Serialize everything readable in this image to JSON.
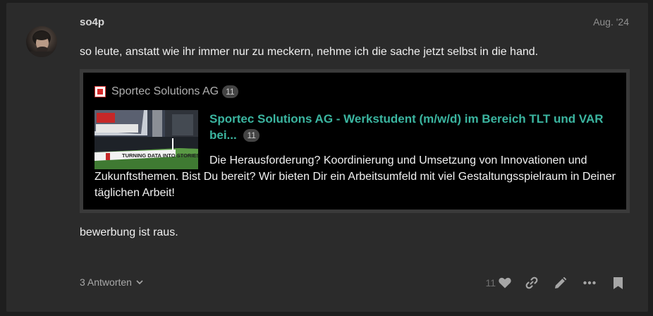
{
  "post": {
    "username": "so4p",
    "date": "Aug. '24",
    "text": "so leute, anstatt wie ihr immer nur zu meckern, nehme ich die sache jetzt selbst in die hand.",
    "text_after": "bewerbung ist raus."
  },
  "onebox": {
    "site_name": "Sportec Solutions AG",
    "site_badge": "11",
    "title": "Sportec Solutions AG - Werkstudent (m/w/d) im Bereich TLT und VAR bei...",
    "title_badge": "11",
    "description": "Die Herausforderung? Koordinierung und Umsetzung von Innovationen und Zukunftsthemen. Bist Du bereit? Wir bieten Dir ein Arbeitsumfeld mit viel Gestaltungsspielraum in Deiner täglichen Arbeit!",
    "thumb_banner_text": "TURNING DATA INTO STORIES",
    "accent_color": "#3bb5a0"
  },
  "footer": {
    "replies_label": "3 Antworten",
    "like_count": "11",
    "icons": [
      "heart-icon",
      "link-icon",
      "pencil-icon",
      "ellipsis-icon",
      "bookmark-icon"
    ]
  }
}
